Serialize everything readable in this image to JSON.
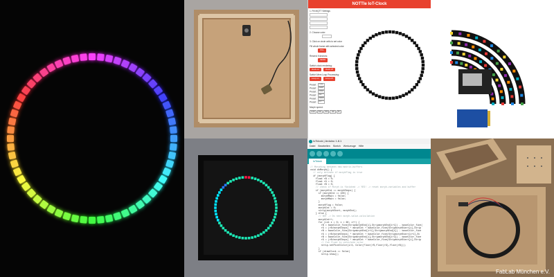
{
  "ui_app": {
    "header_title": "NOTTIe IoT-Clock",
    "sections": [
      "1. Fill MQTT Settings",
      "2. Choose color:",
      "3. Click on circle cells to set color",
      "Fill whole frame with selected color:",
      "Resend if devices:",
      "Switch clock rendering:",
      "Switch Mem Loop Processing:",
      "Morph speed:"
    ],
    "fill_button": "FILL",
    "send_button": "SEND",
    "clock_buttons": [
      "clock on",
      "clock off"
    ],
    "morph_buttons": [
      "Loop on",
      "Loop off"
    ],
    "presets": [
      "Preset:",
      "Preset:",
      "Preset:",
      "Preset:",
      "Preset:",
      "Preset:"
    ],
    "preset_values": [
      "#2e8ffe",
      "#ffa600",
      "#01f0f4",
      "#60c",
      "#8b8000",
      "#17f"
    ],
    "footer_buttons": [
      "1000",
      "500",
      "250",
      "100",
      "50"
    ],
    "ring_cells": 60,
    "accent_color": "#e8412e"
  },
  "ide": {
    "title": "IoTclock | Arduino 1.8.1",
    "menu": [
      "Datei",
      "Bearbeiten",
      "Sketch",
      "Werkzeuge",
      "Hilfe"
    ],
    "tab": "IoTclock",
    "code_lines": [
      "// Morphing between new matrix-buffers",
      "void doMorph() {",
      "  // only ativate if morphFlag is true",
      "  if (morphFlag) {",
      "    float rB = 0;",
      "    float rG = 0;",
      "    float rB = 0;",
      "    // check if Morph is finished -> YES! -> reset morph-variables and buffer",
      "    if (morphCnt == morphSteps) {",
      "      if (morphCnt == 100) {",
      "        morphMain = false;",
      "        morphMain = false;",
      "      }",
      "      morphFlag = false;",
      "      morphCnt = 0;",
      "      strip(morphStart, morphEnd);",
      "    } else {",
      "      // NOT -> Do next morph-value-calculation",
      "      morphCnt++;",
      "      for (int i = 0; i < 60; i++) {",
      "        rB = baseColor_fine(StripmorphEnd[i],StripmorphEnd[i+1]) - baseColor_fine(",
      "        rG = (rB/morphSteps) * morphCnt + baseColor_fine(StripmorphStart[i],Strip",
      "        rB = baseColor_fine(StripmorphEnd[i+1],StripmorphEnd[i]) - baseColor_fine",
      "        rG = (rB/morphSteps) * morphCnt + baseColor_fine(StripmorphStart[i+1],St",
      "        rB = baseColor_fine(StripmorphEnd[i],StripmorphEnd[i+2]) - baseColor_fine",
      "        rG = (rB/morphSteps) * morphCnt + baseColor_fine(StripmorphStart[i],Strip",
      "        // fun float to calculate color",
      "        strip.setPixelColor(i/4, Color(floor(rR,floor(rG),floor(rB)));",
      "      }",
      "      if (drawClock == false)",
      "        strip.show();"
    ]
  },
  "caption": "FabLab München e.V."
}
